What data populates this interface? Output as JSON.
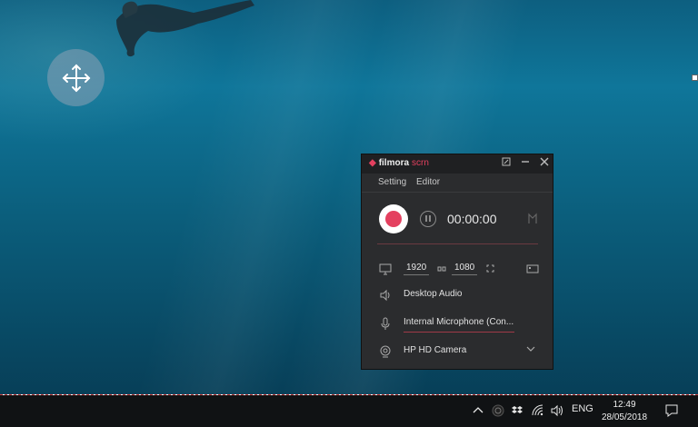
{
  "desktop": {
    "background": "underwater-swimmer",
    "move_icon": "move-arrows-icon"
  },
  "recorder": {
    "logo_text": "filmora",
    "logo_suffix": "scrn",
    "window_buttons": [
      "restore-icon",
      "minimize-icon",
      "close-icon"
    ],
    "menu": {
      "setting": "Setting",
      "editor": "Editor"
    },
    "timer": "00:00:00",
    "accent_color": "#e4405f",
    "resolution": {
      "width": "1920",
      "height": "1080"
    },
    "audio_source": "Desktop Audio",
    "microphone": "Internal Microphone (Con...",
    "camera": "HP HD Camera"
  },
  "taskbar": {
    "language": "ENG",
    "time": "12:49",
    "date": "28/05/2018"
  }
}
